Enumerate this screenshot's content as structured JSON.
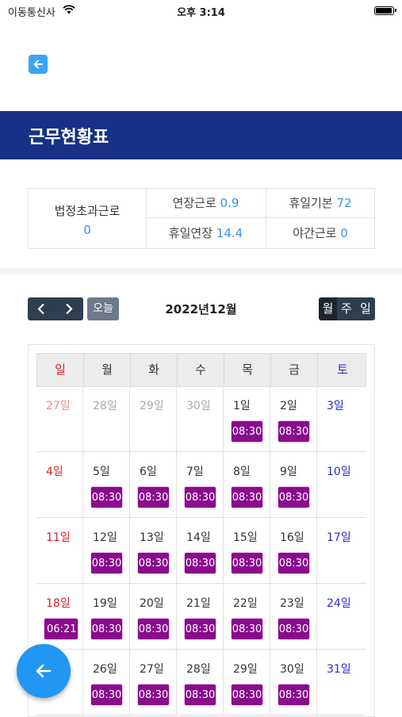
{
  "status_bar": {
    "carrier": "이동통신사",
    "time": "오후 3:14"
  },
  "header": {
    "title": "근무현황표"
  },
  "summary": {
    "main_label": "법정초과근로",
    "main_value": "0",
    "items": [
      {
        "label": "연장근로",
        "value": "0.9"
      },
      {
        "label": "휴일기본",
        "value": "72"
      },
      {
        "label": "휴일연장",
        "value": "14.4"
      },
      {
        "label": "야간근로",
        "value": "0"
      }
    ]
  },
  "calendar": {
    "today_label": "오늘",
    "month_title": "2022년12월",
    "view_buttons": [
      "월",
      "주",
      "일"
    ],
    "selected_view": "월",
    "weekdays": [
      "일",
      "월",
      "화",
      "수",
      "목",
      "금",
      "토"
    ],
    "weeks": [
      [
        {
          "day": "27일",
          "other": true
        },
        {
          "day": "28일",
          "other": true
        },
        {
          "day": "29일",
          "other": true
        },
        {
          "day": "30일",
          "other": true
        },
        {
          "day": "1일",
          "event": "08:30"
        },
        {
          "day": "2일",
          "event": "08:30"
        },
        {
          "day": "3일"
        }
      ],
      [
        {
          "day": "4일"
        },
        {
          "day": "5일",
          "event": "08:30"
        },
        {
          "day": "6일",
          "event": "08:30"
        },
        {
          "day": "7일",
          "event": "08:30"
        },
        {
          "day": "8일",
          "event": "08:30"
        },
        {
          "day": "9일",
          "event": "08:30"
        },
        {
          "day": "10일"
        }
      ],
      [
        {
          "day": "11일"
        },
        {
          "day": "12일",
          "event": "08:30"
        },
        {
          "day": "13일",
          "event": "08:30"
        },
        {
          "day": "14일",
          "event": "08:30"
        },
        {
          "day": "15일",
          "event": "08:30"
        },
        {
          "day": "16일",
          "event": "08:30"
        },
        {
          "day": "17일"
        }
      ],
      [
        {
          "day": "18일",
          "event": "06:21 -"
        },
        {
          "day": "19일",
          "event": "08:30"
        },
        {
          "day": "20일",
          "event": "08:30"
        },
        {
          "day": "21일",
          "event": "08:30"
        },
        {
          "day": "22일",
          "event": "08:30"
        },
        {
          "day": "23일",
          "event": "08:30"
        },
        {
          "day": "24일"
        }
      ],
      [
        {
          "day": ""
        },
        {
          "day": "26일",
          "event": "08:30"
        },
        {
          "day": "27일",
          "event": "08:30"
        },
        {
          "day": "28일",
          "event": "08:30"
        },
        {
          "day": "29일",
          "event": "08:30"
        },
        {
          "day": "30일",
          "event": "08:30"
        },
        {
          "day": "31일"
        }
      ]
    ]
  },
  "colors": {
    "header_bg": "#173186",
    "event_bg": "#8a0c8d",
    "accent_blue": "#3b8fe8",
    "fab_bg": "#2196f3",
    "sunday": "#e02020",
    "saturday": "#2a2ad0"
  },
  "icons": {
    "top_back": "arrow-left-icon",
    "fab": "arrow-left-icon",
    "prev": "chevron-left-icon",
    "next": "chevron-right-icon",
    "wifi": "wifi-icon",
    "battery": "battery-icon"
  }
}
